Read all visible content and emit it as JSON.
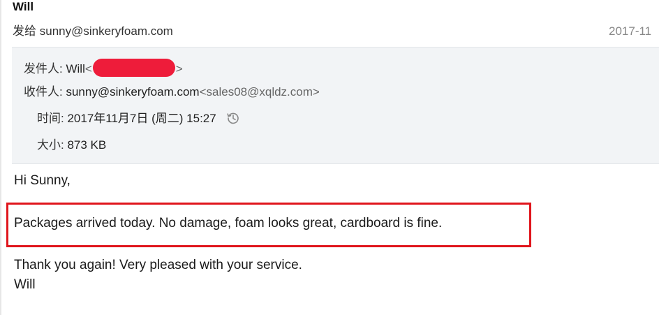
{
  "header": {
    "sender_name": "Will",
    "sent_to_label": "发给",
    "sent_to_address": "sunny@sinkeryfoam.com",
    "date_short": "2017-11"
  },
  "details": {
    "from_label": "发件人:",
    "from_name": "Will",
    "from_open": "<",
    "from_close": ">",
    "to_label": "收件人:",
    "to_address": "sunny@sinkeryfoam.com",
    "to_alias": "<sales08@xqldz.com>",
    "time_label": "时间:",
    "time_value": "2017年11月7日 (周二) 15:27",
    "size_label": "大小:",
    "size_value": "873 KB"
  },
  "body": {
    "greeting": "Hi Sunny,",
    "highlighted": "Packages arrived today. No damage, foam looks great, cardboard is fine.",
    "thanks": "Thank you again! Very pleased with your service.",
    "signature": "Will"
  },
  "colors": {
    "highlight_border": "#e0151c",
    "redaction": "#ee1c3a",
    "panel_bg": "#f2f4f6"
  },
  "icons": {
    "time": "history-icon"
  }
}
